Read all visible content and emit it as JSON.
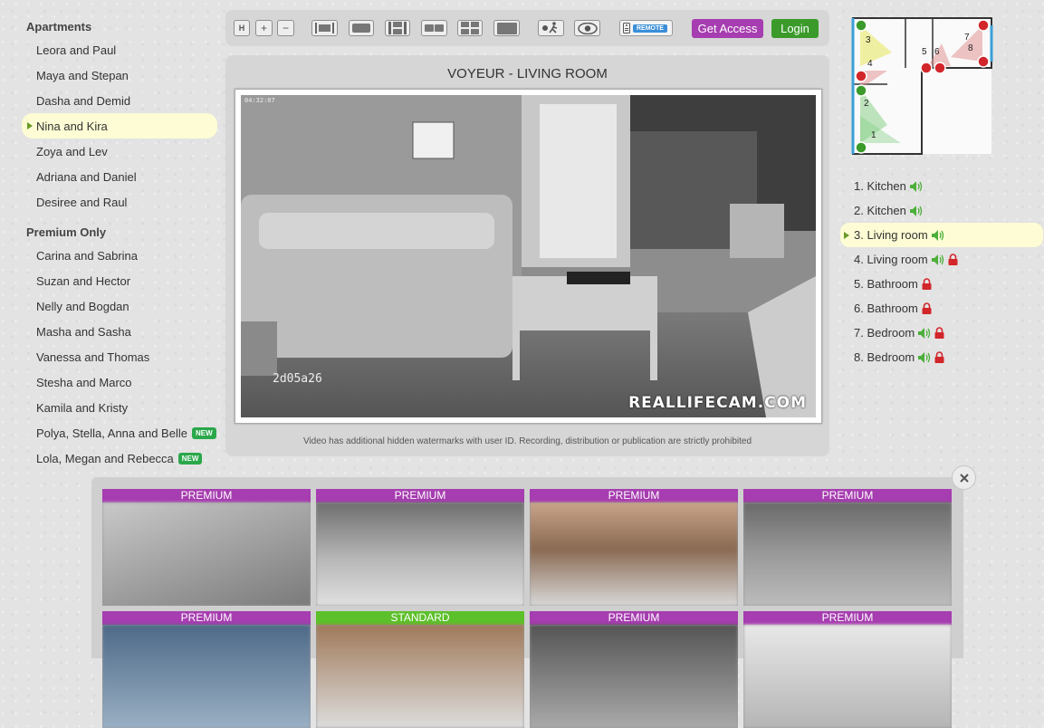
{
  "sidebar": {
    "sections": [
      {
        "title": "Apartments",
        "items": [
          {
            "label": "Leora and Paul"
          },
          {
            "label": "Maya and Stepan"
          },
          {
            "label": "Dasha and Demid"
          },
          {
            "label": "Nina and Kira",
            "active": true
          },
          {
            "label": "Zoya and Lev"
          },
          {
            "label": "Adriana and Daniel"
          },
          {
            "label": "Desiree and Raul"
          }
        ]
      },
      {
        "title": "Premium Only",
        "items": [
          {
            "label": "Carina and Sabrina"
          },
          {
            "label": "Suzan and Hector"
          },
          {
            "label": "Nelly and Bogdan"
          },
          {
            "label": "Masha and Sasha"
          },
          {
            "label": "Vanessa and Thomas"
          },
          {
            "label": "Stesha and Marco"
          },
          {
            "label": "Kamila and Kristy"
          },
          {
            "label": "Polya, Stella, Anna and Belle",
            "badge": "NEW"
          },
          {
            "label": "Lola, Megan and Rebecca",
            "badge": "NEW"
          }
        ]
      }
    ]
  },
  "toolbar": {
    "h_label": "H",
    "zoom_in": "+",
    "zoom_out": "−",
    "remote_label": "REMOTE",
    "get_access": "Get Access",
    "login": "Login"
  },
  "video": {
    "title": "VOYEUR - LIVING ROOM",
    "timestamp": "04:32:07",
    "watermark_id": "2d05a26",
    "watermark_brand": "REALLIFECAM.COM",
    "disclaimer": "Video has additional hidden watermarks with user ID. Recording, distribution or publication are strictly prohibited"
  },
  "floorplan": {
    "room_numbers": [
      "1",
      "2",
      "3",
      "4",
      "5",
      "6",
      "7",
      "8"
    ]
  },
  "cameras": [
    {
      "label": "1. Kitchen",
      "sound": true,
      "locked": false
    },
    {
      "label": "2. Kitchen",
      "sound": true,
      "locked": false
    },
    {
      "label": "3. Living room",
      "sound": true,
      "locked": false,
      "active": true
    },
    {
      "label": "4. Living room",
      "sound": true,
      "locked": true
    },
    {
      "label": "5. Bathroom",
      "sound": false,
      "locked": true
    },
    {
      "label": "6. Bathroom",
      "sound": false,
      "locked": true
    },
    {
      "label": "7. Bedroom",
      "sound": true,
      "locked": true
    },
    {
      "label": "8. Bedroom",
      "sound": true,
      "locked": true
    }
  ],
  "grid": {
    "tiles": [
      {
        "label": "PREMIUM",
        "tier": "premium"
      },
      {
        "label": "PREMIUM",
        "tier": "premium"
      },
      {
        "label": "PREMIUM",
        "tier": "premium"
      },
      {
        "label": "PREMIUM",
        "tier": "premium"
      },
      {
        "label": "PREMIUM",
        "tier": "premium"
      },
      {
        "label": "STANDARD",
        "tier": "standard"
      },
      {
        "label": "PREMIUM",
        "tier": "premium"
      },
      {
        "label": "PREMIUM",
        "tier": "premium"
      }
    ]
  },
  "colors": {
    "premium": "#a63db0",
    "standard": "#5cc02a",
    "accent_green": "#3a9a2a",
    "active_bg": "#fdfcd4",
    "lock_red": "#d2262a",
    "sound_green": "#4caf3a"
  },
  "icons": {
    "sound": "speaker-icon",
    "lock": "lock-icon",
    "close": "close-icon"
  }
}
